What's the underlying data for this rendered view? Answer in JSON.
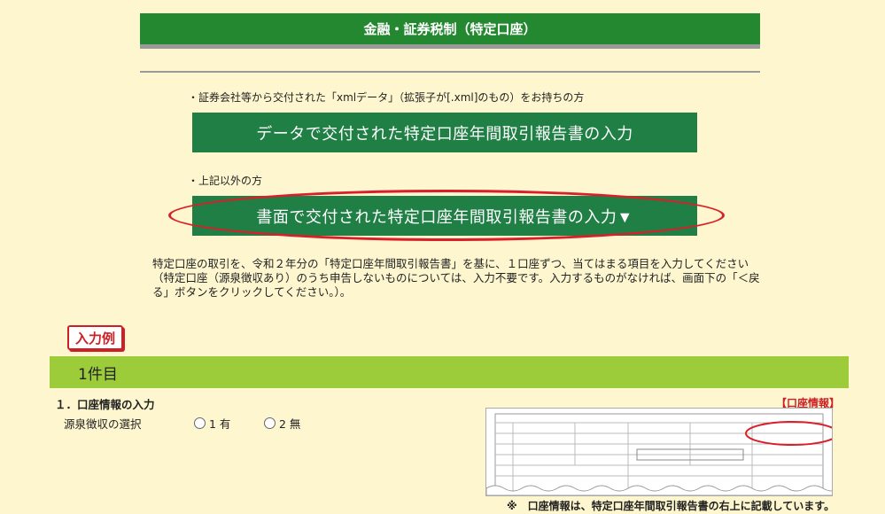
{
  "header": {
    "title": "金融・証券税制（特定口座）"
  },
  "intro": {
    "xml_note": "・証券会社等から交付された「xmlデータ」（拡張子が[.xml]のもの）をお持ちの方",
    "xml_button": "データで交付された特定口座年間取引報告書の入力",
    "other_note": "・上記以外の方",
    "paper_button": "書面で交付された特定口座年間取引報告書の入力▼"
  },
  "description": "特定口座の取引を、令和２年分の「特定口座年間取引報告書」を基に、１口座ずつ、当てはまる項目を入力してください（特定口座（源泉徴収あり）のうち申告しないものについては、入力不要です。入力するものがなければ、画面下の「＜戻る」ボタンをクリックしてください。）。",
  "example_badge": "入力例",
  "section": {
    "title": "1件目"
  },
  "account": {
    "heading": "１．口座情報の入力",
    "info_tag": "【口座情報】",
    "withholding_label": "源泉徴収の選択",
    "option1": "1  有",
    "option2": "2  無"
  },
  "doc_caption": "※　口座情報は、特定口座年間取引報告書の右上に記載しています。"
}
